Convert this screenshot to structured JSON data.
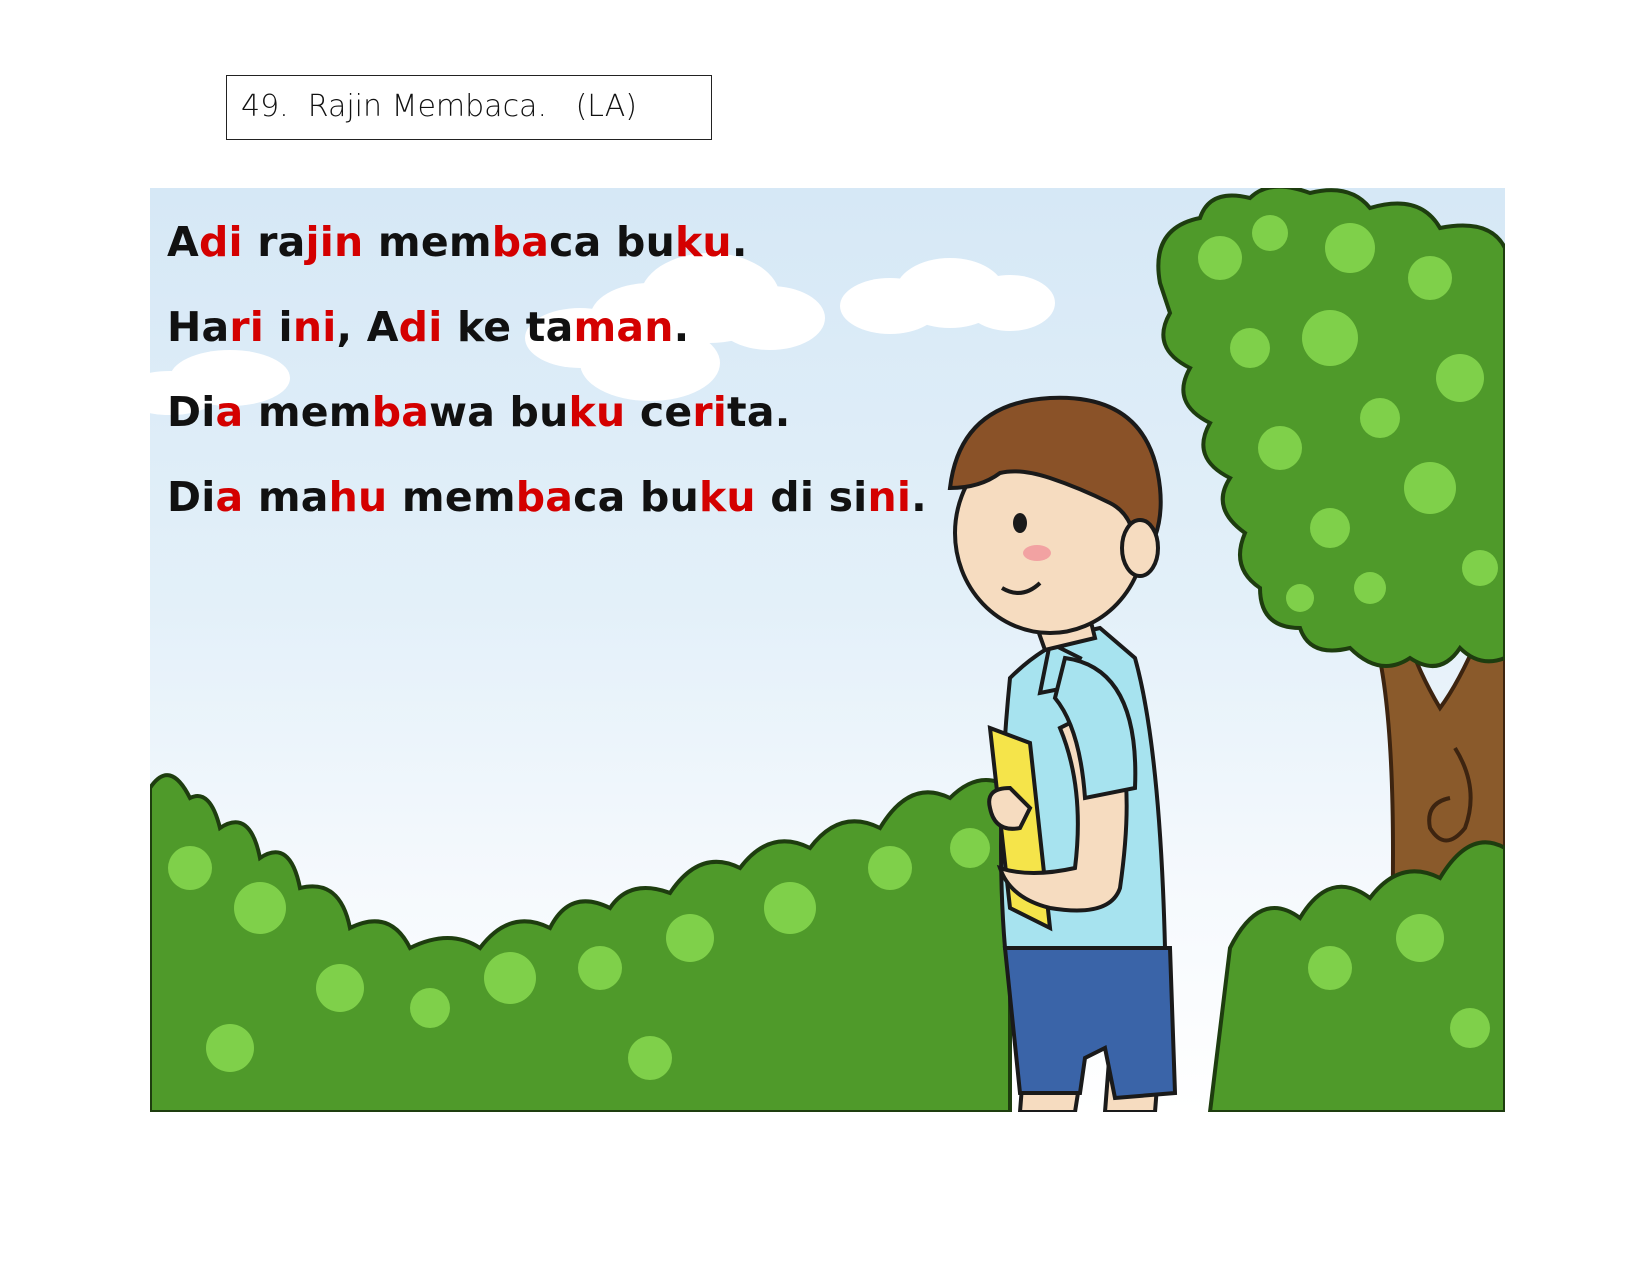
{
  "title": "49.  Rajin Membaca.   (LA)",
  "colors": {
    "highlight": "#d40000",
    "text": "#111111",
    "sky": "#d6e8f6",
    "foliage": "#4f9a2a"
  },
  "sentences": [
    {
      "parts": [
        {
          "t": "A",
          "hl": false
        },
        {
          "t": "di",
          "hl": true
        },
        {
          "t": " ra",
          "hl": false
        },
        {
          "t": "jin",
          "hl": true
        },
        {
          "t": " mem",
          "hl": false
        },
        {
          "t": "ba",
          "hl": true
        },
        {
          "t": "ca bu",
          "hl": false
        },
        {
          "t": "ku",
          "hl": true
        },
        {
          "t": ".",
          "hl": false
        }
      ]
    },
    {
      "parts": [
        {
          "t": "Ha",
          "hl": false
        },
        {
          "t": "ri",
          "hl": true
        },
        {
          "t": " i",
          "hl": false
        },
        {
          "t": "ni",
          "hl": true
        },
        {
          "t": ", A",
          "hl": false
        },
        {
          "t": "di",
          "hl": true
        },
        {
          "t": " ke ta",
          "hl": false
        },
        {
          "t": "man",
          "hl": true
        },
        {
          "t": ".",
          "hl": false
        }
      ]
    },
    {
      "parts": [
        {
          "t": "Di",
          "hl": false
        },
        {
          "t": "a",
          "hl": true
        },
        {
          "t": " mem",
          "hl": false
        },
        {
          "t": "ba",
          "hl": true
        },
        {
          "t": "wa bu",
          "hl": false
        },
        {
          "t": "ku",
          "hl": true
        },
        {
          "t": " ce",
          "hl": false
        },
        {
          "t": "ri",
          "hl": true
        },
        {
          "t": "ta.",
          "hl": false
        }
      ]
    },
    {
      "parts": [
        {
          "t": "Di",
          "hl": false
        },
        {
          "t": "a",
          "hl": true
        },
        {
          "t": " ma",
          "hl": false
        },
        {
          "t": "hu",
          "hl": true
        },
        {
          "t": " mem",
          "hl": false
        },
        {
          "t": "ba",
          "hl": true
        },
        {
          "t": "ca bu",
          "hl": false
        },
        {
          "t": "ku",
          "hl": true
        },
        {
          "t": " di si",
          "hl": false
        },
        {
          "t": "ni",
          "hl": true
        },
        {
          "t": ".",
          "hl": false
        }
      ]
    }
  ],
  "illustration": {
    "icon": "boy-reading-book-in-park-illustration"
  }
}
